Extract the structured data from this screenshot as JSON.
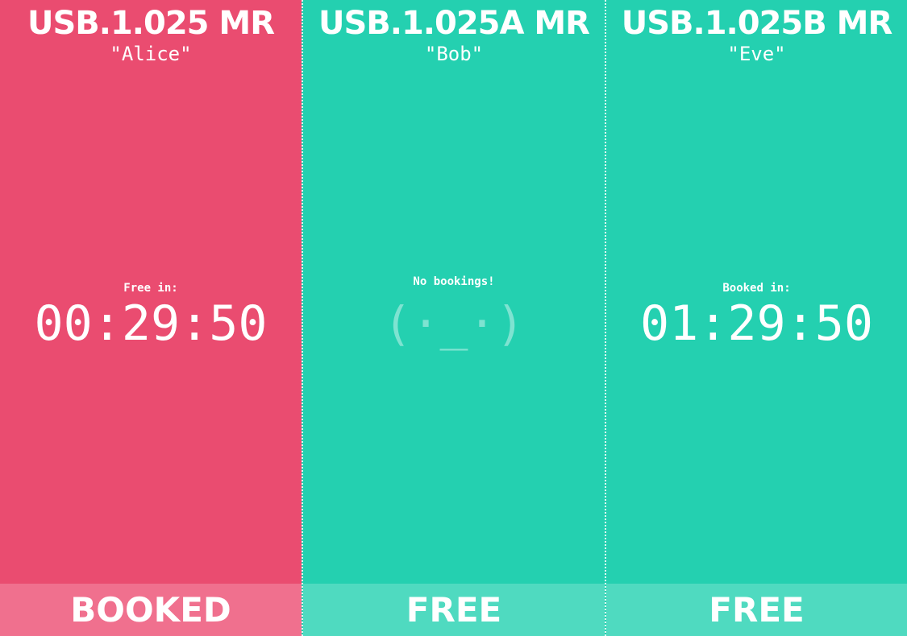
{
  "colors": {
    "booked_bg": "#ea4c70",
    "booked_bar": "#f0708e",
    "free_bg": "#24d0b0",
    "free_bar": "#4fdac0",
    "face": "#7ee3d1"
  },
  "rooms": [
    {
      "id": "USB.1.025 MR",
      "name": "\"Alice\"",
      "caption": "Free in:",
      "timer": "00:29:50",
      "status": "BOOKED",
      "state": "booked"
    },
    {
      "id": "USB.1.025A MR",
      "name": "\"Bob\"",
      "caption": "No bookings!",
      "face": "(·_·)",
      "status": "FREE",
      "state": "free"
    },
    {
      "id": "USB.1.025B MR",
      "name": "\"Eve\"",
      "caption": "Booked in:",
      "timer": "01:29:50",
      "status": "FREE",
      "state": "free"
    }
  ]
}
